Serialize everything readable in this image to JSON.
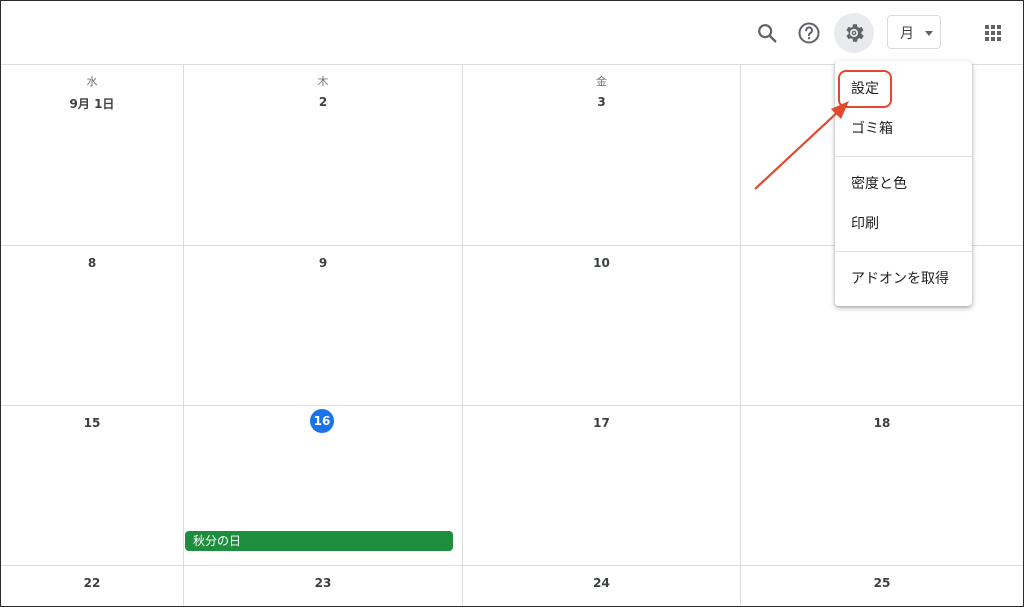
{
  "toolbar": {
    "icons": [
      "search-icon",
      "help-icon",
      "gear-icon",
      "apps-grid-icon"
    ],
    "view_label": "月"
  },
  "calendar": {
    "weekdays": [
      "水",
      "木",
      "金"
    ],
    "rows": [
      [
        "9月 1日",
        "2",
        "3",
        ""
      ],
      [
        "8",
        "9",
        "10",
        ""
      ],
      [
        "15",
        "16",
        "17",
        "18"
      ],
      [
        "22",
        "23",
        "24",
        "25"
      ]
    ],
    "today": "16",
    "event_label": "秋分の日"
  },
  "settings_menu": {
    "items": [
      "設定",
      "ゴミ箱",
      "密度と色",
      "印刷",
      "アドオンを取得"
    ]
  },
  "colors": {
    "today": "#1a73e8",
    "event": "#1e8e3e",
    "annotation": "#e0492f"
  }
}
